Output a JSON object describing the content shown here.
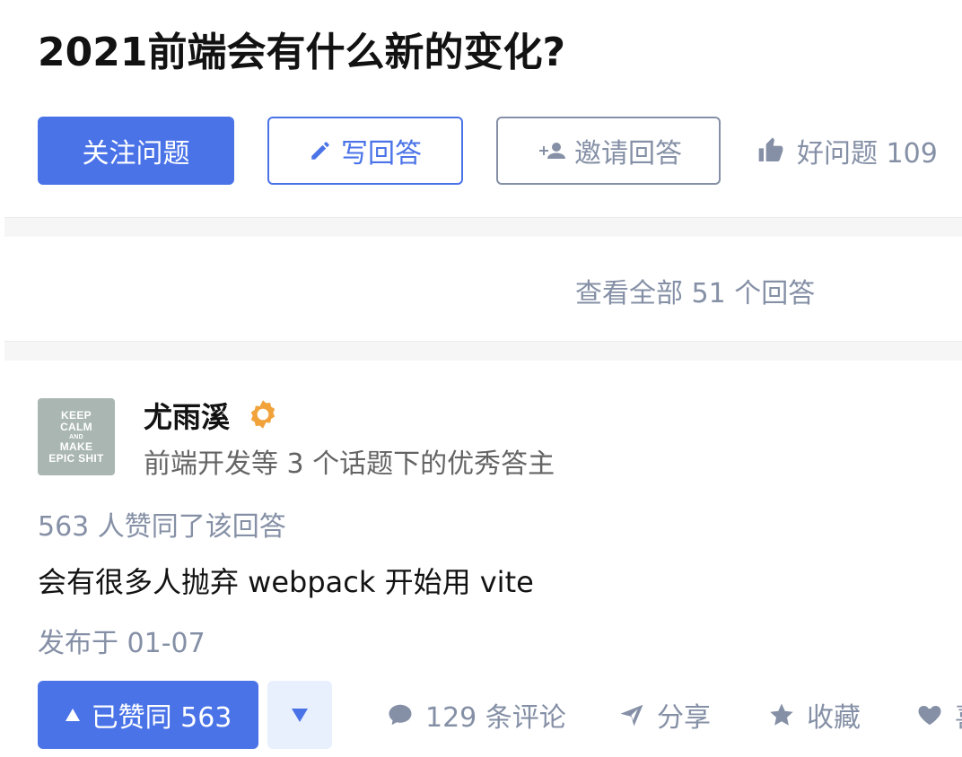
{
  "question": {
    "title": "2021前端会有什么新的变化?"
  },
  "actions": {
    "follow_label": "关注问题",
    "write_label": "写回答",
    "invite_label": "邀请回答",
    "good_question_label": "好问题 109"
  },
  "view_all_label": "查看全部 51 个回答",
  "answer": {
    "author": {
      "name": "尤雨溪",
      "description": "前端开发等 3 个话题下的优秀答主",
      "avatar_text": [
        "KEEP",
        "CALM",
        "AND",
        "MAKE",
        "EPIC SHIT"
      ]
    },
    "vote_info": "563 人赞同了该回答",
    "content": "会有很多人抛弃 webpack 开始用 vite",
    "published": "发布于 01-07",
    "upvote_label": "已赞同 563",
    "comment_label": "129 条评论",
    "share_label": "分享",
    "collect_label": "收藏",
    "like_label": "喜"
  },
  "colors": {
    "primary": "#4a73e8",
    "muted": "#8590a6",
    "badge": "#f1a23b",
    "downvote_bg": "#e8effd"
  },
  "icons": {
    "write": "pencil-icon",
    "invite": "add-user-icon",
    "good_question": "thumb-up-icon",
    "badge": "excellent-badge-icon",
    "upvote": "triangle-up-icon",
    "downvote": "triangle-down-icon",
    "comment": "comment-icon",
    "share": "paper-plane-icon",
    "collect": "star-icon",
    "like": "heart-icon"
  }
}
